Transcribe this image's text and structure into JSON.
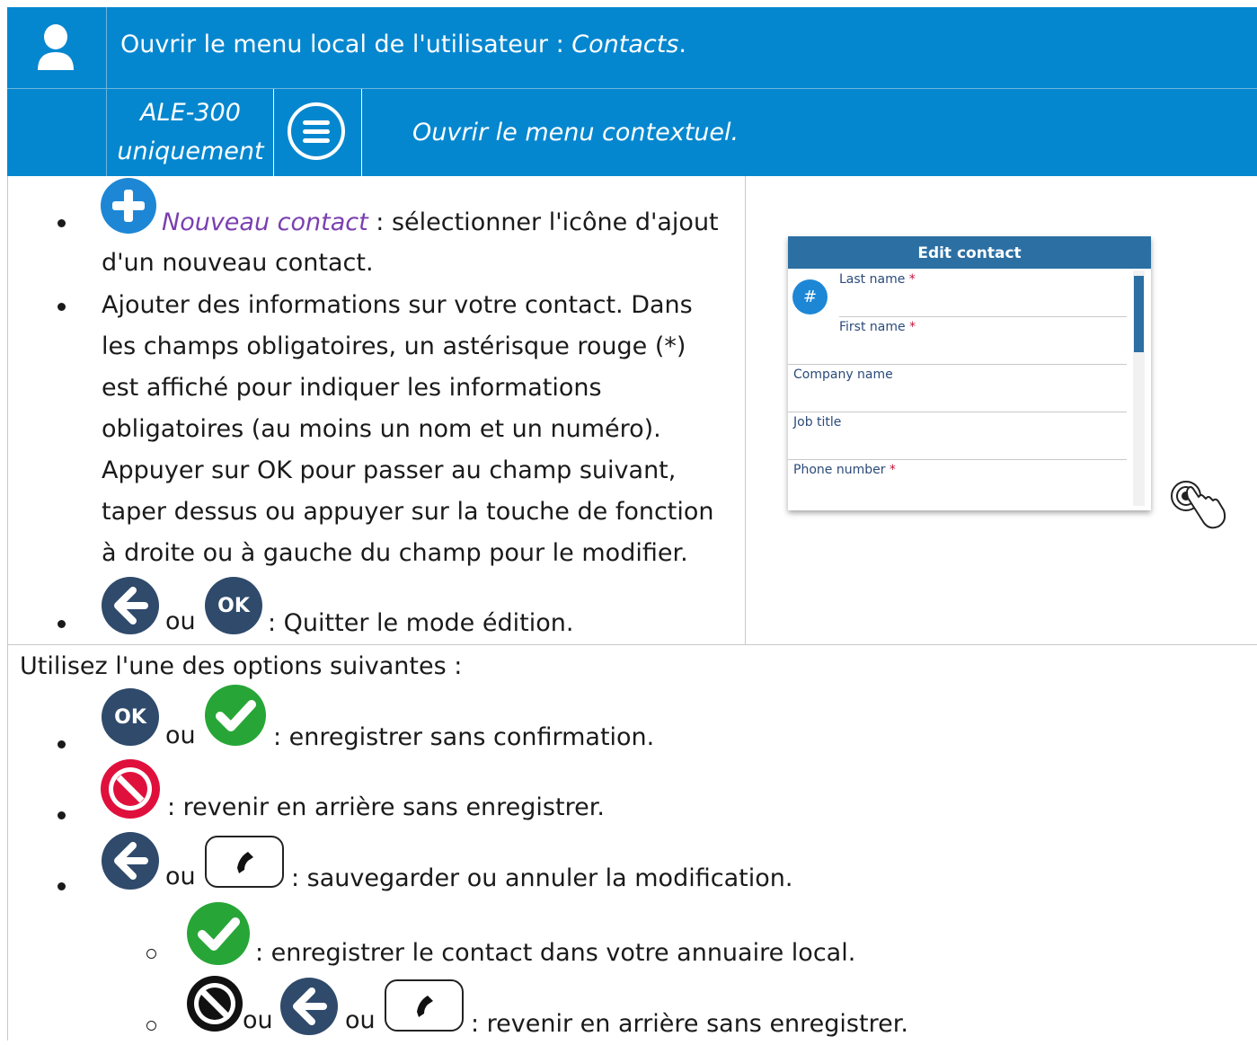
{
  "header": {
    "title_prefix": "Ouvrir le menu local de l'utilisateur : ",
    "title_italic": "Contacts",
    "title_suffix": "."
  },
  "subheader": {
    "model_line1": "ALE-300",
    "model_line2": "uniquement",
    "action": "Ouvrir le menu contextuel."
  },
  "steps": {
    "new_contact_link": "Nouveau contact",
    "new_contact_text_1": " : sélectionner l'icône d'ajout",
    "new_contact_text_2": "d'un nouveau contact.",
    "add_info_lines": [
      "Ajouter des informations sur votre contact. Dans",
      "les champs obligatoires, un astérisque rouge (*)",
      "est affiché pour indiquer les informations",
      "obligatoires (au moins un nom et un numéro).",
      "Appuyer sur OK pour passer au champ suivant,",
      "taper dessus ou appuyer sur la touche de fonction",
      "à droite ou à gauche du champ pour le modifier."
    ],
    "ou": "ou",
    "ok_label": "OK",
    "quit_text": ": Quitter le mode édition."
  },
  "edit_contact": {
    "title": "Edit contact",
    "avatar_symbol": "#",
    "fields": [
      "Last name",
      "First name",
      "Company name",
      "Job title",
      "Phone number"
    ],
    "star": "*"
  },
  "options": {
    "intro": "Utilisez l'une des options suivantes :",
    "save_text": ": enregistrer sans confirmation.",
    "cancel_text": ": revenir en arrière sans enregistrer.",
    "save_or_cancel_text": ": sauvegarder ou annuler la modification.",
    "save_local_text": ": enregistrer le contact dans votre annuaire local.",
    "back_text": ": revenir en arrière sans enregistrer."
  },
  "icons": {
    "user": "user-icon",
    "menu": "menu-icon",
    "plus": "plus-circle-icon",
    "back": "back-arrow-icon",
    "ok": "ok-icon",
    "check": "check-circle-icon",
    "forbidden": "forbidden-icon",
    "phone": "phone-icon",
    "touch": "touch-gesture-icon"
  },
  "colors": {
    "header_blue": "#0587cf",
    "dark_button": "#2f4a6b",
    "green": "#27a637",
    "red": "#e0103c",
    "purple_link": "#7a3fb0"
  }
}
